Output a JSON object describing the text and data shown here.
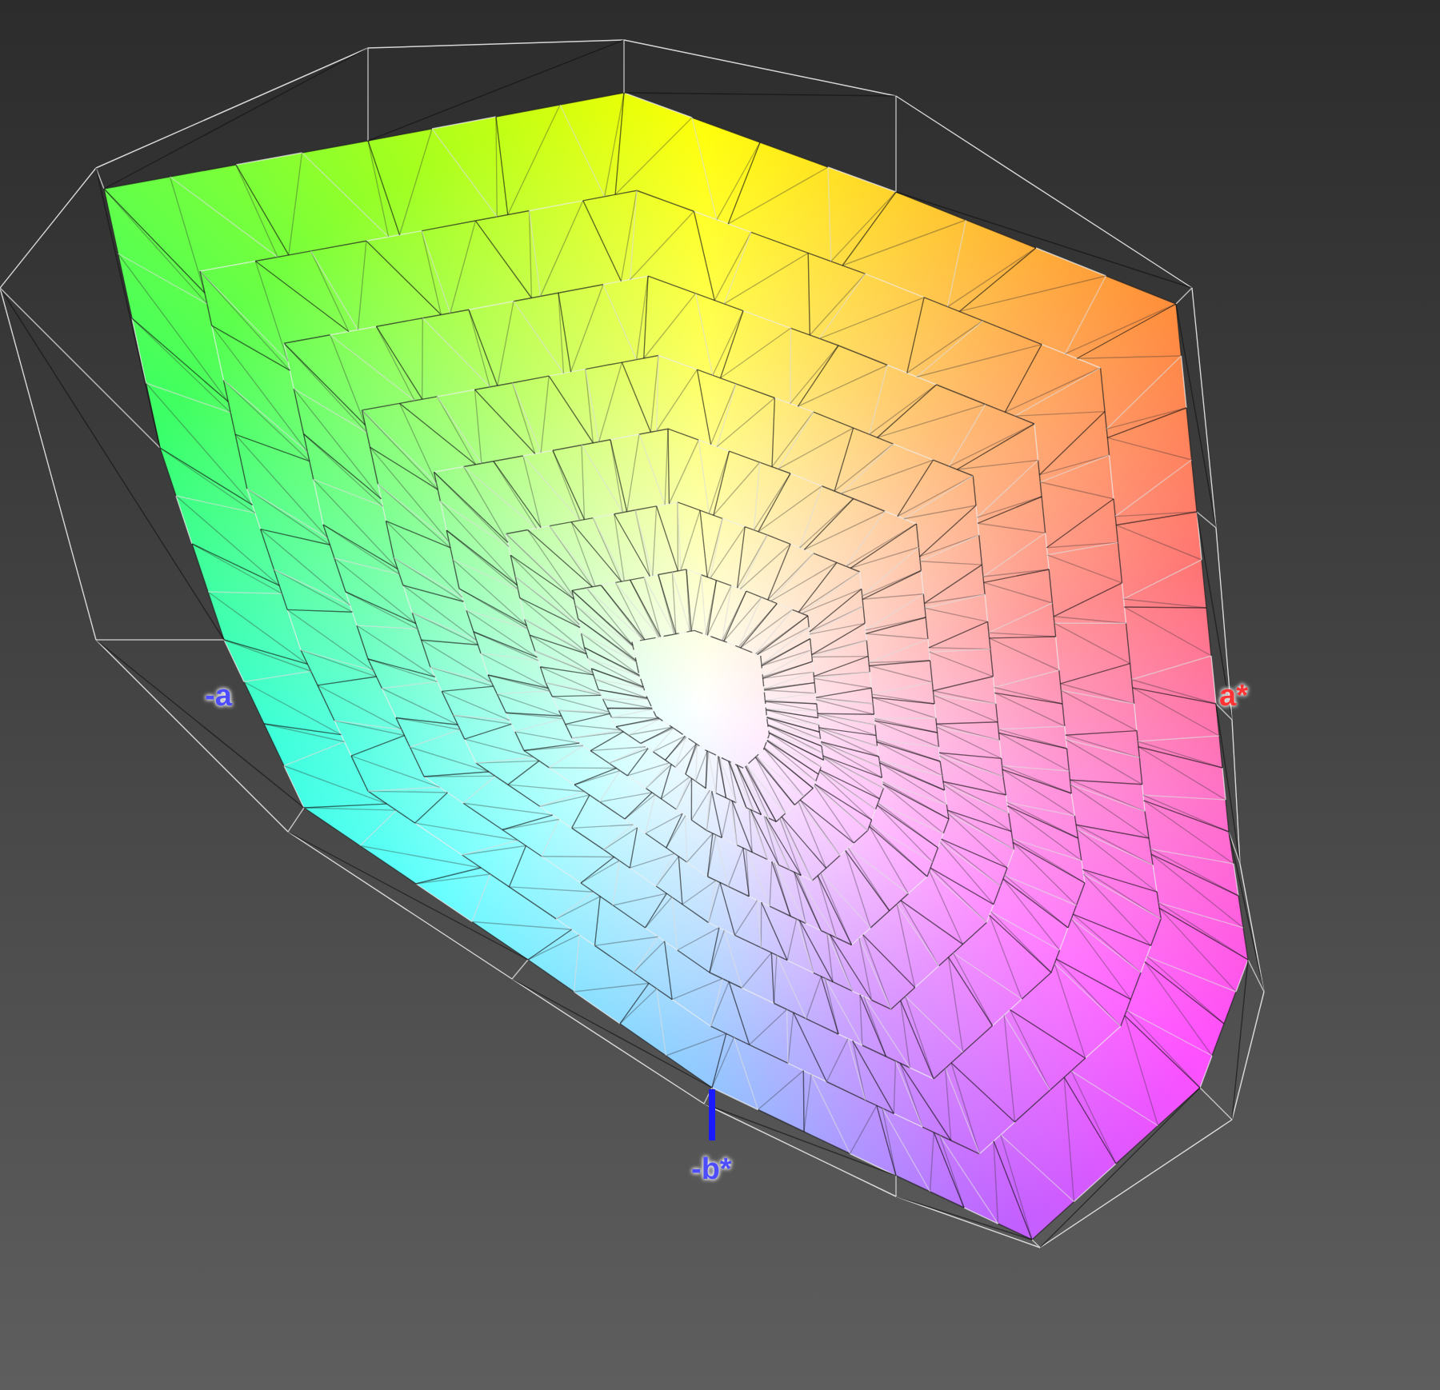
{
  "axis_labels": [
    {
      "kind": "left",
      "text": "-a",
      "color": "#4d4dff"
    },
    {
      "kind": "right",
      "text": "a*",
      "color": "#ff3333"
    },
    {
      "kind": "bottom",
      "text": "-b*",
      "color": "#4d4dff"
    }
  ]
}
